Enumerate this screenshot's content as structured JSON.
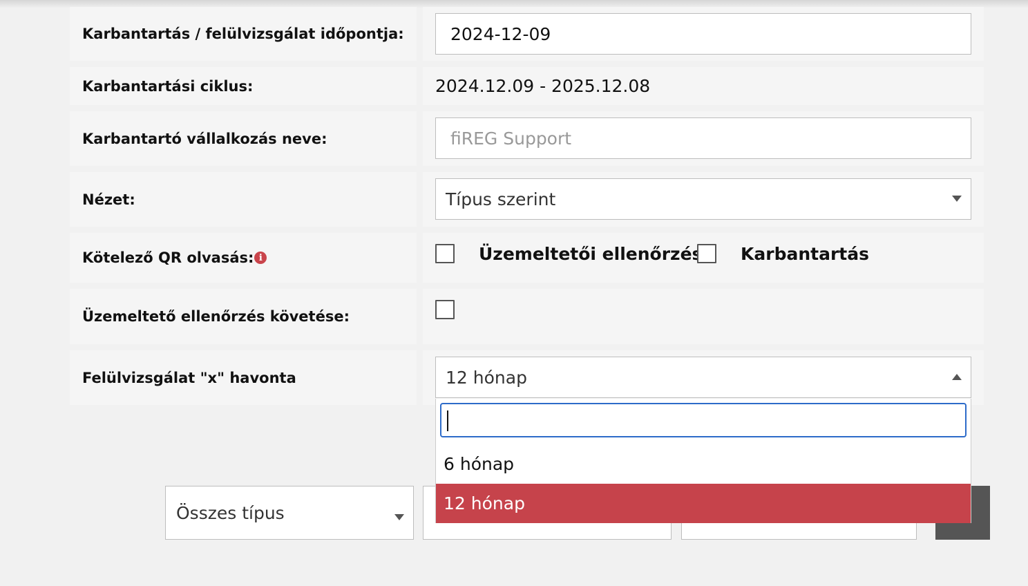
{
  "form": {
    "date": {
      "label": "Karbantartás / felülvizsgálat időpontja:",
      "value": "2024-12-09"
    },
    "cycle": {
      "label": "Karbantartási ciklus:",
      "value": "2024.12.09 - 2025.12.08"
    },
    "company": {
      "label": "Karbantartó vállalkozás neve:",
      "placeholder": "fiREG Support"
    },
    "view": {
      "label": "Nézet:",
      "selected": "Típus szerint"
    },
    "qr": {
      "label": "Kötelező QR olvasás:",
      "info_glyph": "i",
      "option1": "Üzemeltetői ellenőrzés",
      "option2": "Karbantartás"
    },
    "follow": {
      "label": "Üzemeltető ellenőrzés követése:"
    },
    "interval": {
      "label": "Felülvizsgálat \"x\" havonta",
      "selected": "12 hónap"
    }
  },
  "dropdown": {
    "search_value": "",
    "options": [
      "6 hónap",
      "12 hónap"
    ],
    "highlight_color": "#c6434b"
  },
  "bottom": {
    "type_filter": "Összes típus"
  },
  "colors": {
    "accent": "#c6434b",
    "focus": "#2d6bc9"
  }
}
